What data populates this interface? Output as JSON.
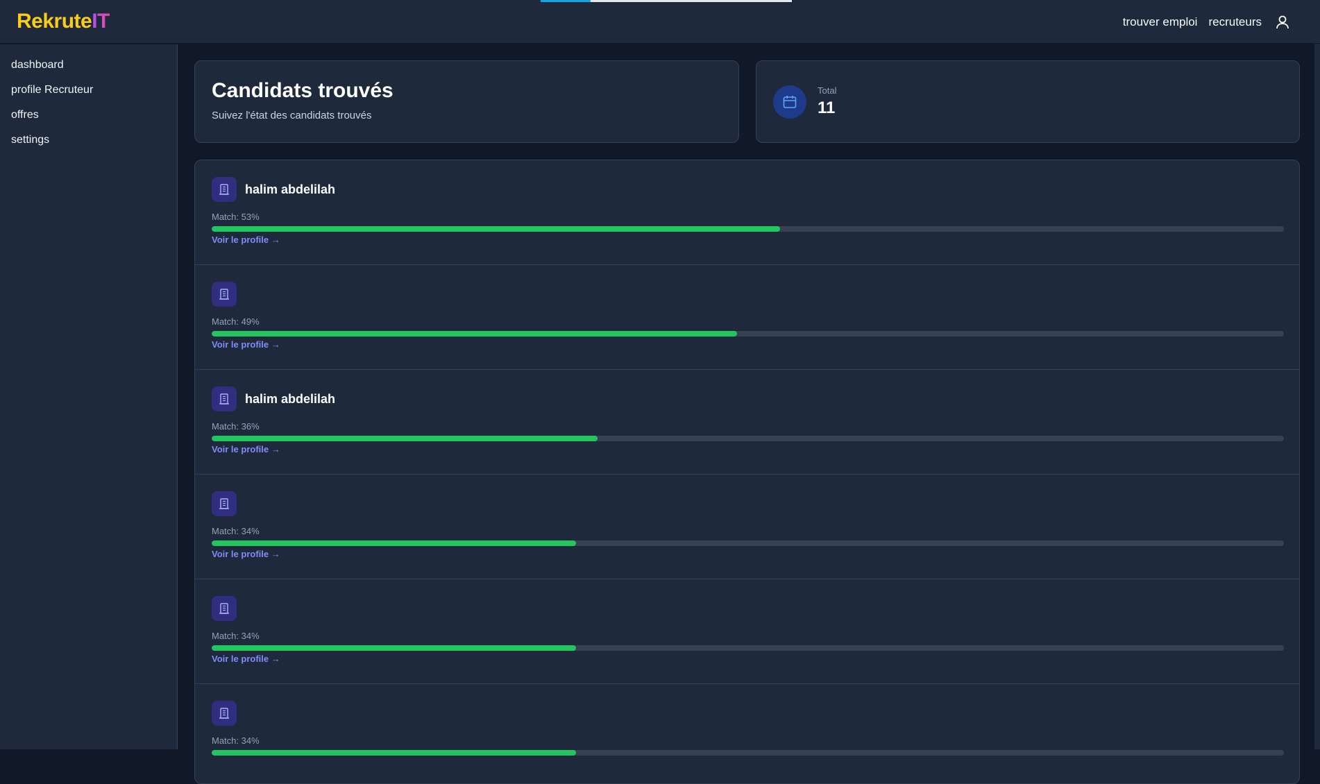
{
  "app": {
    "logo_part1": "Rekrute",
    "logo_part2": "IT",
    "loading_progress_percent": 20
  },
  "topnav": {
    "items": [
      "trouver emploi",
      "recruteurs"
    ]
  },
  "sidebar": {
    "items": [
      "dashboard",
      "profile Recruteur",
      "offres",
      "settings"
    ]
  },
  "header": {
    "title": "Candidats trouvés",
    "subtitle": "Suivez l'état des candidats trouvés"
  },
  "stats": {
    "label": "Total",
    "value": "11"
  },
  "candidates": [
    {
      "name": "halim abdelilah",
      "match_label": "Match: 53%",
      "match": 53,
      "link": "Voir le profile →"
    },
    {
      "name": "",
      "match_label": "Match: 49%",
      "match": 49,
      "link": "Voir le profile →"
    },
    {
      "name": "halim abdelilah",
      "match_label": "Match: 36%",
      "match": 36,
      "link": "Voir le profile →"
    },
    {
      "name": "",
      "match_label": "Match: 34%",
      "match": 34,
      "link": "Voir le profile →"
    },
    {
      "name": "",
      "match_label": "Match: 34%",
      "match": 34,
      "link": "Voir le profile →"
    },
    {
      "name": "",
      "match_label": "Match: 34%",
      "match": 34,
      "link": ""
    }
  ],
  "colors": {
    "background": "#111827",
    "panel": "#1e293b",
    "accent": "#818cf8",
    "progress": "#22c55e",
    "logo_primary": "#facc15"
  },
  "icons": {
    "stat": "calendar-icon",
    "candidate": "building-icon",
    "user": "user-icon"
  }
}
